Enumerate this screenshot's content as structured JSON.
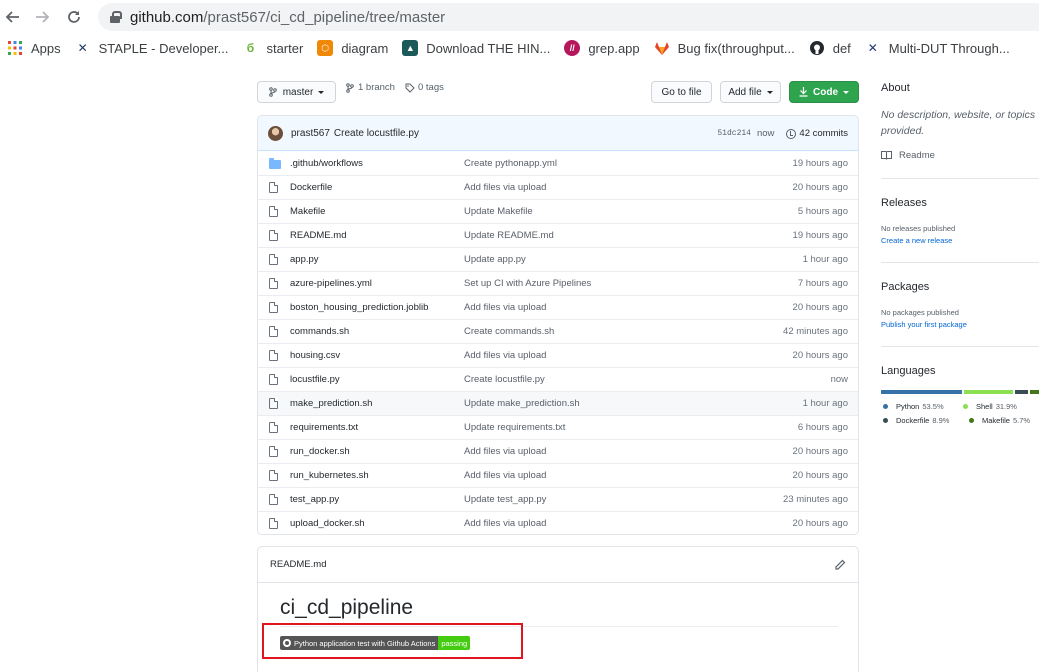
{
  "browser": {
    "url_host": "github.com",
    "url_path": "/prast567/ci_cd_pipeline/tree/master",
    "bookmarks": [
      {
        "label": "Apps",
        "icon": "apps-grid-icon"
      },
      {
        "label": "STAPLE - Developer...",
        "icon": "staple-icon"
      },
      {
        "label": "starter",
        "icon": "starter-icon"
      },
      {
        "label": "diagram",
        "icon": "diagram-icon"
      },
      {
        "label": "Download THE HIN...",
        "icon": "hin-icon"
      },
      {
        "label": "grep.app",
        "icon": "grep-icon"
      },
      {
        "label": "Bug fix(throughput...",
        "icon": "gitlab-icon"
      },
      {
        "label": "def",
        "icon": "github-icon"
      },
      {
        "label": "Multi-DUT Through...",
        "icon": "staple-icon"
      }
    ]
  },
  "repo": {
    "branch_button": "master",
    "branches": "1 branch",
    "tags": "0 tags",
    "go_to_file": "Go to file",
    "add_file": "Add file",
    "code": "Code"
  },
  "commit": {
    "author": "prast567",
    "message": "Create locustfile.py",
    "sha": "51dc214",
    "time": "now",
    "commits": "42 commits"
  },
  "files": [
    {
      "name": ".github/workflows",
      "msg": "Create pythonapp.yml",
      "age": "19 hours ago",
      "type": "folder"
    },
    {
      "name": "Dockerfile",
      "msg": "Add files via upload",
      "age": "20 hours ago",
      "type": "file"
    },
    {
      "name": "Makefile",
      "msg": "Update Makefile",
      "age": "5 hours ago",
      "type": "file"
    },
    {
      "name": "README.md",
      "msg": "Update README.md",
      "age": "19 hours ago",
      "type": "file"
    },
    {
      "name": "app.py",
      "msg": "Update app.py",
      "age": "1 hour ago",
      "type": "file"
    },
    {
      "name": "azure-pipelines.yml",
      "msg": "Set up CI with Azure Pipelines",
      "age": "7 hours ago",
      "type": "file"
    },
    {
      "name": "boston_housing_prediction.joblib",
      "msg": "Add files via upload",
      "age": "20 hours ago",
      "type": "file"
    },
    {
      "name": "commands.sh",
      "msg": "Create commands.sh",
      "age": "42 minutes ago",
      "type": "file"
    },
    {
      "name": "housing.csv",
      "msg": "Add files via upload",
      "age": "20 hours ago",
      "type": "file"
    },
    {
      "name": "locustfile.py",
      "msg": "Create locustfile.py",
      "age": "now",
      "type": "file"
    },
    {
      "name": "make_prediction.sh",
      "msg": "Update make_prediction.sh",
      "age": "1 hour ago",
      "type": "file"
    },
    {
      "name": "requirements.txt",
      "msg": "Update requirements.txt",
      "age": "6 hours ago",
      "type": "file"
    },
    {
      "name": "run_docker.sh",
      "msg": "Add files via upload",
      "age": "20 hours ago",
      "type": "file"
    },
    {
      "name": "run_kubernetes.sh",
      "msg": "Add files via upload",
      "age": "20 hours ago",
      "type": "file"
    },
    {
      "name": "test_app.py",
      "msg": "Update test_app.py",
      "age": "23 minutes ago",
      "type": "file"
    },
    {
      "name": "upload_docker.sh",
      "msg": "Add files via upload",
      "age": "20 hours ago",
      "type": "file"
    }
  ],
  "readme": {
    "filename": "README.md",
    "title": "ci_cd_pipeline",
    "badge_label": "Python application test with Github Actions",
    "badge_status": "passing"
  },
  "sidebar": {
    "about_heading": "About",
    "about_text": "No description, website, or topics provided.",
    "readme_link": "Readme",
    "releases_heading": "Releases",
    "releases_none": "No releases published",
    "releases_link": "Create a new release",
    "packages_heading": "Packages",
    "packages_none": "No packages published",
    "packages_link": "Publish your first package",
    "languages_heading": "Languages",
    "languages": [
      {
        "name": "Python",
        "pct": "53.5%",
        "color": "#3572A5"
      },
      {
        "name": "Shell",
        "pct": "31.9%",
        "color": "#89e051"
      },
      {
        "name": "Dockerfile",
        "pct": "8.9%",
        "color": "#384d54"
      },
      {
        "name": "Makefile",
        "pct": "5.7%",
        "color": "#427819"
      }
    ]
  }
}
